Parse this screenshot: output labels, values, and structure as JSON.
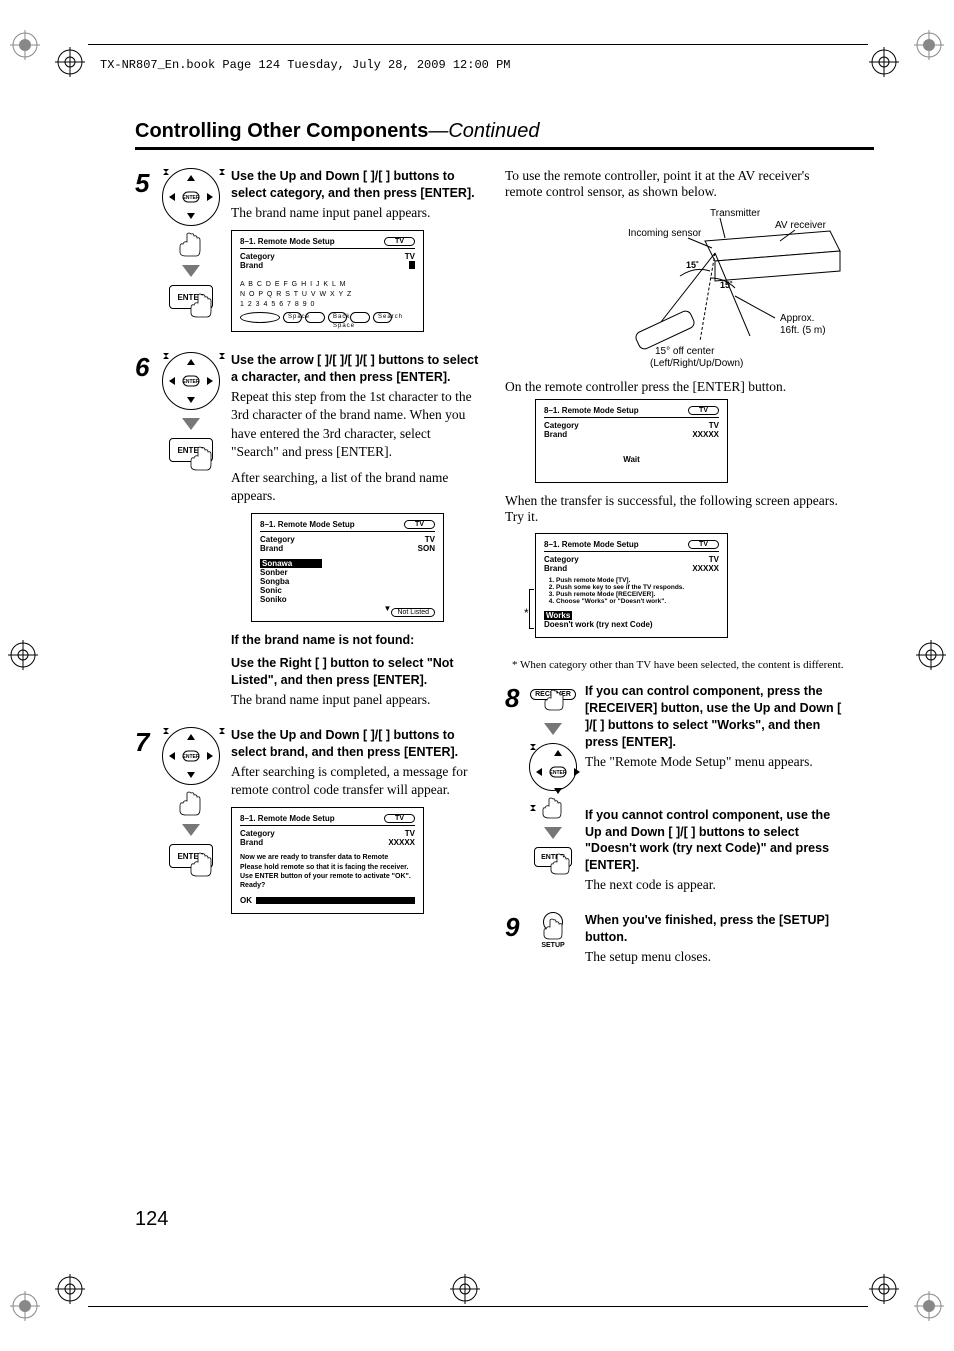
{
  "meta": {
    "header_line": "TX-NR807_En.book  Page 124  Tuesday, July 28, 2009  12:00 PM",
    "page_number": "124",
    "title_main": "Controlling Other Components",
    "title_cont": "—Continued"
  },
  "step5": {
    "num": "5",
    "heading": "Use the Up and Down [   ]/[   ] buttons to select category, and then press [ENTER].",
    "body": "The brand name input panel appears.",
    "osd": {
      "title": "8–1.   Remote Mode Setup",
      "pill": "TV",
      "cat_label": "Category",
      "cat_val": "TV",
      "brand_label": "Brand",
      "brand_val": "",
      "letters_row1": "A B C D E F G H I J K L M",
      "letters_row2": "N O P Q R S T U V W X Y Z",
      "letters_row3": "1 2 3 4 5 6 7 8 9 0",
      "btn1": "Space",
      "btn2": "Back Space",
      "btn3": "Search"
    },
    "enter_label": "ENTER",
    "dpad_label": "ENTER"
  },
  "step6": {
    "num": "6",
    "heading": "Use the arrow [   ]/[   ]/[   ]/[   ] buttons to select a character, and then press [ENTER].",
    "body1": "Repeat this step from the 1st character to the 3rd character of the brand name. When you have entered the 3rd character, select \"Search\" and press [ENTER].",
    "body2": "After searching, a list of the brand name appears.",
    "osd": {
      "title": "8–1.   Remote Mode Setup",
      "pill": "TV",
      "cat_label": "Category",
      "cat_val": "TV",
      "brand_label": "Brand",
      "brand_val": "SON",
      "list": [
        "Sonawa",
        "Sonber",
        "Songba",
        "Sonic",
        "Soniko"
      ],
      "not_listed": "Not Listed"
    },
    "sub_heading1": "If the brand name is not found:",
    "sub_heading2": "Use the Right [    ] button to select \"Not Listed\", and then press [ENTER].",
    "body3": "The brand name input panel appears."
  },
  "step7": {
    "num": "7",
    "heading": "Use the Up and Down [   ]/[   ] buttons to select brand, and then press [ENTER].",
    "body": "After searching is completed, a message for remote control code transfer will appear.",
    "osd": {
      "title": "8–1.   Remote Mode Setup",
      "pill": "TV",
      "cat_label": "Category",
      "cat_val": "TV",
      "brand_label": "Brand",
      "brand_val": "XXXXX",
      "msg_lines": [
        "Now we are ready to transfer data to Remote",
        "Please hold remote so that it is facing the receiver.",
        "Use ENTER button of your remote to activate \"OK\".",
        "Ready?"
      ],
      "ok": "OK"
    }
  },
  "right_intro": "To use the remote controller, point it at the AV receiver's remote control sensor, as shown below.",
  "rx_diag": {
    "transmitter": "Transmitter",
    "av_receiver": "AV receiver",
    "incoming": "Incoming sensor",
    "angle1": "15˚",
    "angle2": "15˚",
    "approx": "Approx.\n16ft. (5 m)",
    "offcenter": "15° off center\n(Left/Right/Up/Down)"
  },
  "right_body1": "On the remote controller press the [ENTER] button.",
  "osd_wait": {
    "title": "8–1.   Remote Mode Setup",
    "pill": "TV",
    "cat_label": "Category",
    "cat_val": "TV",
    "brand_label": "Brand",
    "brand_val": "XXXXX",
    "wait": "Wait"
  },
  "right_body2": "When the transfer is successful, the following screen appears. Try it.",
  "osd_try": {
    "title": "8–1.   Remote Mode Setup",
    "pill": "TV",
    "cat_label": "Category",
    "cat_val": "TV",
    "brand_label": "Brand",
    "brand_val": "XXXXX",
    "steps": [
      "Push remote Mode [TV].",
      "Push some key to see if the TV responds.",
      "Push remote Mode [RECEIVER].",
      "Choose \"Works\" or \"Doesn't work\"."
    ],
    "star": "*",
    "opt1": "Works",
    "opt2": "Doesn't work (try next Code)"
  },
  "footnote": "* When category other than TV have been selected, the content is different.",
  "step8": {
    "num": "8",
    "heading1": "If you can control component, press the [RECEIVER] button, use the Up and Down [   ]/[   ] buttons to select \"Works\", and then press [ENTER].",
    "body1": "The \"Remote Mode Setup\" menu appears.",
    "heading2": "If you cannot control component, use the Up and Down [   ]/[   ] buttons to select \"Doesn't work (try next Code)\" and press [ENTER].",
    "body2": "The next code is appear.",
    "receiver_label": "RECEIVER",
    "enter_label": "ENTER"
  },
  "step9": {
    "num": "9",
    "heading": "When you've finished, press the [SETUP] button.",
    "body": "The setup menu closes.",
    "setup_label": "SETUP"
  }
}
